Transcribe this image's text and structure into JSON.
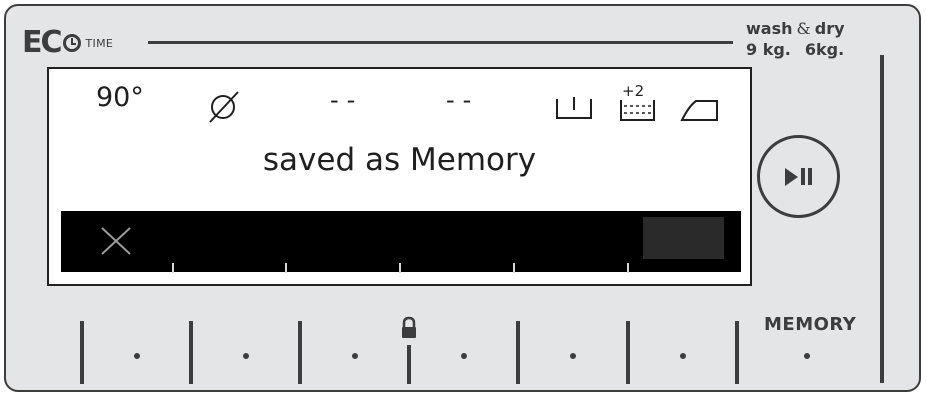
{
  "brand": {
    "eco": "EC",
    "time": "TIME"
  },
  "capacity": {
    "title_wash": "wash",
    "title_amp": "&",
    "title_dry": "dry",
    "wash_kg": "9 kg.",
    "dry_kg": "6kg."
  },
  "display": {
    "temperature": "90°",
    "spin_icon": "no-spin-icon",
    "dash_1": "--",
    "dash_2": "--",
    "extra_rinse_plus": "+2",
    "message": "saved as Memory",
    "cancel_icon": "close-icon"
  },
  "controls": {
    "start_pause_icon": "play-pause-icon",
    "memory_label": "MEMORY",
    "lock_icon": "lock-icon"
  },
  "colors": {
    "panel": "#e4e5e7",
    "ink": "#3d3d3f",
    "screen": "#ffffff",
    "progress": "#000000"
  }
}
